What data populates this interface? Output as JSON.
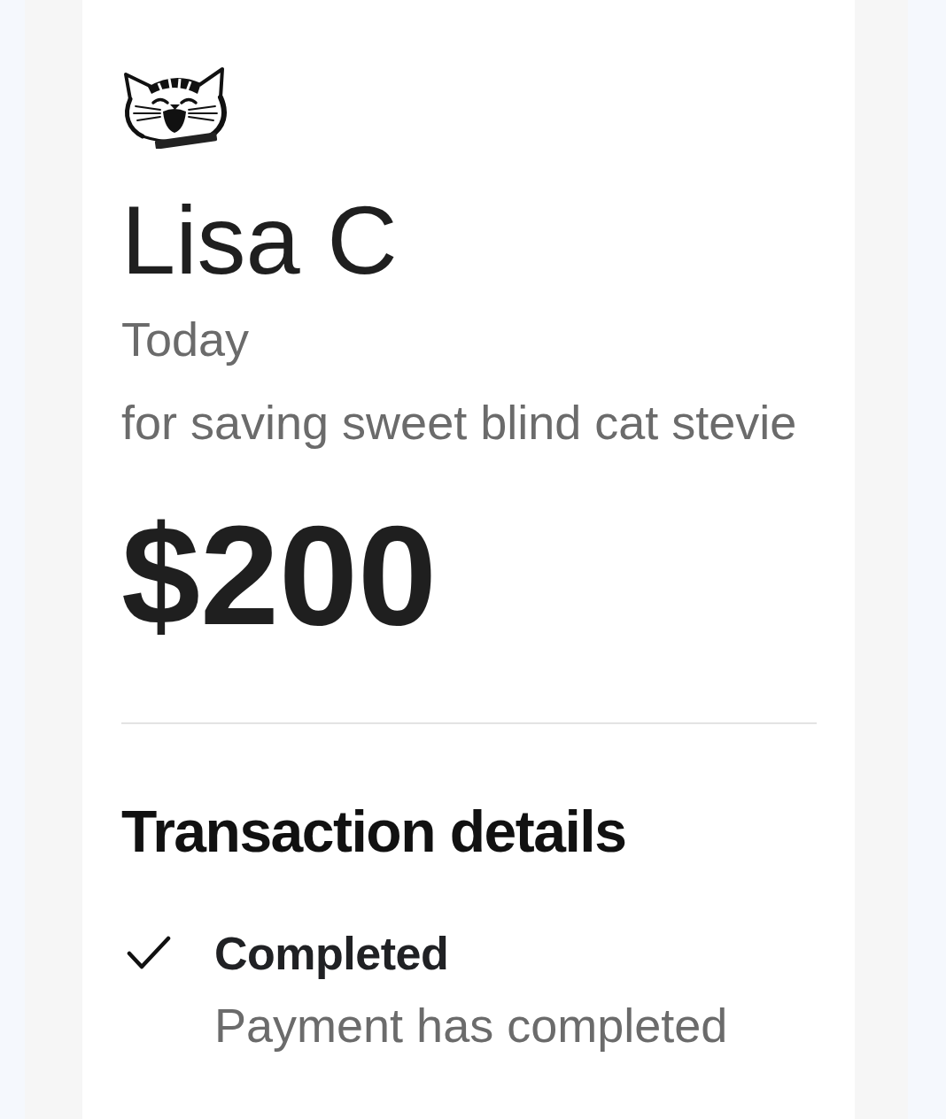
{
  "recipient": {
    "name": "Lisa C",
    "date": "Today",
    "note": "for saving sweet blind cat stevie",
    "amount": "$200"
  },
  "transaction_details": {
    "title": "Transaction details",
    "status": {
      "label": "Completed",
      "description": "Payment has completed"
    }
  }
}
